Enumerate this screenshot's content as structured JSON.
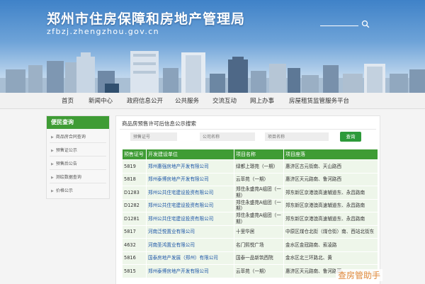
{
  "header": {
    "title": "郑州市住房保障和房地产管理局",
    "domain": "zfbzj.zhengzhou.gov.cn"
  },
  "nav": {
    "items": [
      "首页",
      "新闻中心",
      "政府信息公开",
      "公共服务",
      "交流互动",
      "网上办事",
      "房屋租赁监管服务平台"
    ]
  },
  "sidebar": {
    "title": "便民查询",
    "items": [
      "商品房合同查询",
      "预售证公示",
      "预售后公告",
      "测绘数据查询",
      "价格公示"
    ]
  },
  "main": {
    "title": "商品房预售许可后信息公示搜索",
    "search": {
      "permit_placeholder": "预售证号",
      "company_placeholder": "公司名称",
      "project_placeholder": "项目名称",
      "query_label": "查询"
    }
  },
  "table": {
    "headers": [
      "预售证号",
      "开发建设单位",
      "项目名称",
      "项目座落"
    ],
    "rows": [
      [
        "5819",
        "郑州惠强房地产开发有限公司",
        "绿都上璟苑（一期）",
        "惠济区古元街南、天山路西"
      ],
      [
        "5818",
        "郑州泰博房地产开发有限公司",
        "云萃苑（一期）",
        "惠济区天元路南、鲁河路西"
      ],
      [
        "D1283",
        "郑州公共住宅建设投资有限公司",
        "郑住永盛苑A组团（一期）",
        "郑东新区京港澳高速辅道东、永昌路南"
      ],
      [
        "D1282",
        "郑州公共住宅建设投资有限公司",
        "郑住永盛苑A组团（一期）",
        "郑东新区京港澳高速辅道东、永昌路南"
      ],
      [
        "D1281",
        "郑州公共住宅建设投资有限公司",
        "郑住永盛苑A组团（一期）",
        "郑东新区京港澳高速辅道东、永昌路南"
      ],
      [
        "5817",
        "河南泛悦置业有限公司",
        "十里华居",
        "中原区煤仓北街（煤仓街）南、西站北街东"
      ],
      [
        "4632",
        "河南圣鸿置业有限公司",
        "名门熙悦广场",
        "金水区金冠路南、索凌路"
      ],
      [
        "5816",
        "国泰房地产发展（郑州）有限公司",
        "国泰一品新筑西院",
        "金水区北三环路北、黄"
      ],
      [
        "5815",
        "郑州泰博房地产开发有限公司",
        "云萃苑（一期）",
        "惠济区天元路南、鲁河路西"
      ]
    ]
  },
  "watermark": "查房管助手",
  "colors": {
    "green": "#3f9c35",
    "button_green": "#2d9a3a",
    "link_blue": "#1b55a6",
    "row_bg": "#eef6ea"
  }
}
